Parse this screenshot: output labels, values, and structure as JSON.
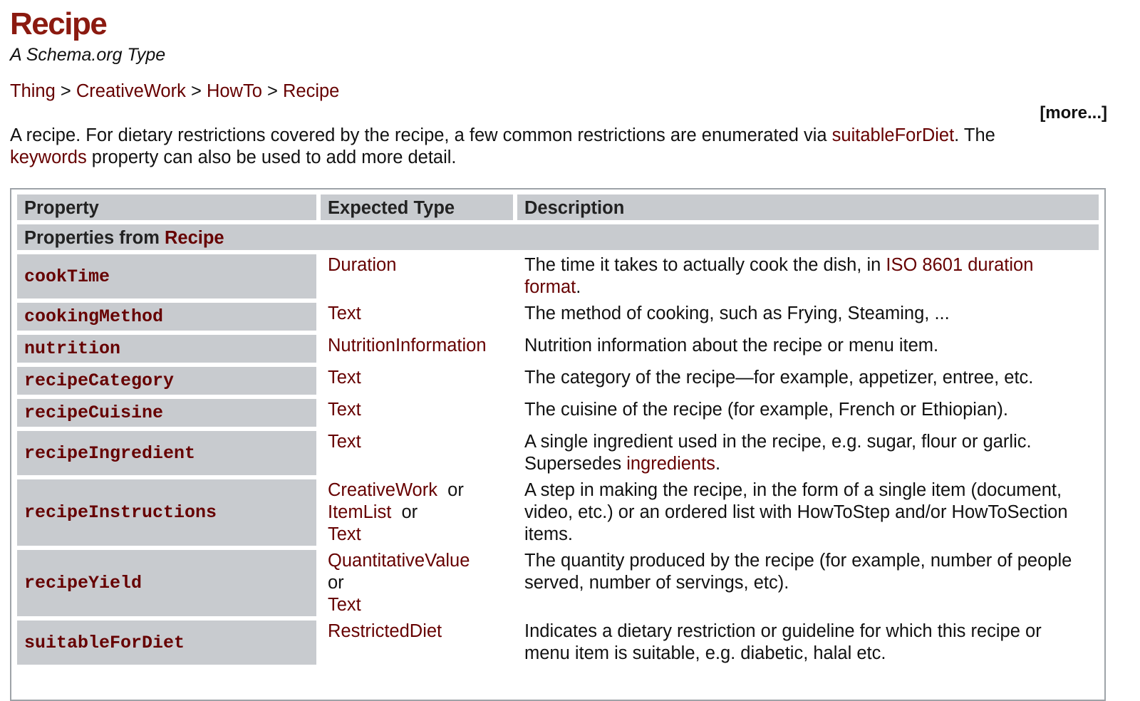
{
  "header": {
    "title": "Recipe",
    "subtitle": "A Schema.org Type",
    "breadcrumb": [
      {
        "label": "Thing"
      },
      {
        "label": "CreativeWork"
      },
      {
        "label": "HowTo"
      },
      {
        "label": "Recipe"
      }
    ],
    "breadcrumb_separator": ">",
    "more_label": "[more...]"
  },
  "description": {
    "part1": "A recipe. For dietary restrictions covered by the recipe, a few common restrictions are enumerated via ",
    "link1": "suitableForDiet",
    "part2": ". The ",
    "link2": "keywords",
    "part3": " property can also be used to add more detail."
  },
  "table": {
    "headers": {
      "property": "Property",
      "expected_type": "Expected Type",
      "description": "Description"
    },
    "section": {
      "prefix": "Properties from ",
      "link": "Recipe"
    },
    "or_word": "or",
    "rows": [
      {
        "property": "cookTime",
        "types": [
          "Duration"
        ],
        "description": "The time it takes to actually cook the dish, in ",
        "desc_link": "ISO 8601 duration format",
        "desc_suffix": "."
      },
      {
        "property": "cookingMethod",
        "types": [
          "Text"
        ],
        "description": "The method of cooking, such as Frying, Steaming, ..."
      },
      {
        "property": "nutrition",
        "types": [
          "NutritionInformation"
        ],
        "description": "Nutrition information about the recipe or menu item."
      },
      {
        "property": "recipeCategory",
        "types": [
          "Text"
        ],
        "description": "The category of the recipe—for example, appetizer, entree, etc."
      },
      {
        "property": "recipeCuisine",
        "types": [
          "Text"
        ],
        "description": "The cuisine of the recipe (for example, French or Ethiopian)."
      },
      {
        "property": "recipeIngredient",
        "types": [
          "Text"
        ],
        "description": "A single ingredient used in the recipe, e.g. sugar, flour or garlic. Supersedes ",
        "desc_link": "ingredients",
        "desc_suffix": "."
      },
      {
        "property": "recipeInstructions",
        "types": [
          "CreativeWork",
          "ItemList",
          "Text"
        ],
        "description": "A step in making the recipe, in the form of a single item (document, video, etc.) or an ordered list with HowToStep and/or HowToSection items."
      },
      {
        "property": "recipeYield",
        "types": [
          "QuantitativeValue",
          "Text"
        ],
        "types_or_on_own_line": true,
        "description": "The quantity produced by the recipe (for example, number of people served, number of servings, etc)."
      },
      {
        "property": "suitableForDiet",
        "types": [
          "RestrictedDiet"
        ],
        "description": "Indicates a dietary restriction or guideline for which this recipe or menu item is suitable, e.g. diabetic, halal etc."
      }
    ]
  },
  "colors": {
    "title": "#8b1a10",
    "link": "#660000",
    "header_bg": "#c8cbcf",
    "text": "#111111"
  }
}
